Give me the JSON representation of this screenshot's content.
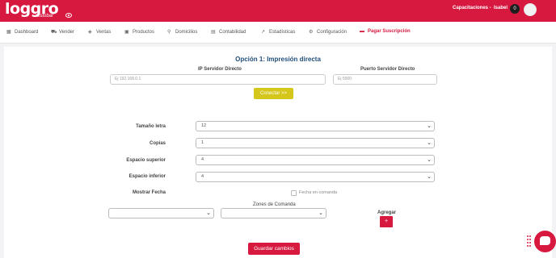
{
  "brand": {
    "logo_text": "loggro",
    "logo_sub": "restobar"
  },
  "header": {
    "company": "Capacitaciones -",
    "user": "Isabel",
    "notifications": "0"
  },
  "nav": [
    {
      "label": "Dashboard",
      "icon": "dashboard-icon"
    },
    {
      "label": "Vender",
      "icon": "cart-icon"
    },
    {
      "label": "Ventas",
      "icon": "tag-icon"
    },
    {
      "label": "Productos",
      "icon": "box-icon"
    },
    {
      "label": "Domicilios",
      "icon": "bike-icon"
    },
    {
      "label": "Contabilidad",
      "icon": "calculator-icon"
    },
    {
      "label": "Estadísticas",
      "icon": "chart-line-icon"
    },
    {
      "label": "Configuración",
      "icon": "gear-icon"
    },
    {
      "label": "Pagar Suscripción",
      "icon": "credit-card-icon"
    }
  ],
  "section": {
    "title": "Opción 1: Impresión directa",
    "ip_label": "IP Servidor Directo",
    "ip_placeholder": "Ej 192.168.0.1",
    "port_label": "Puerto Servidor Directo",
    "port_placeholder": "Ej 5000",
    "connect_button": "Conectar >>"
  },
  "settings": {
    "font_size_label": "Tamaño letra",
    "font_size_value": "12",
    "copies_label": "Copias",
    "copies_value": "1",
    "top_space_label": "Espacio superior",
    "top_space_value": "4",
    "bottom_space_label": "Espacio inferior",
    "bottom_space_value": "4",
    "show_date_label": "Mostrar Fecha",
    "date_checkbox_label": "Fecha en comanda"
  },
  "zones": {
    "label": "Zones de Comanda",
    "add_label": "Agregar",
    "add_button": "+"
  },
  "save_button": "Guardar cambios",
  "colors": {
    "accent": "#d7193f",
    "connect": "#d4c61a",
    "title": "#1f4e79"
  }
}
